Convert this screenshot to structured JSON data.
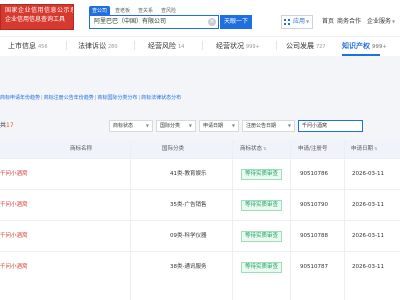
{
  "header": {
    "logo_line1": "国家企业信用信息公示系统",
    "logo_line2": "企业信用信息查询工具",
    "search_tabs": [
      "查公司",
      "查老板",
      "查关系",
      "查风险"
    ],
    "search_value": "阿里巴巴（中国）有限公司",
    "search_button": "天眼一下",
    "apps_label": "应用",
    "links": [
      "首页",
      "商务合作",
      "企业服务"
    ]
  },
  "tabs": [
    {
      "label": "上市信息",
      "count": "456"
    },
    {
      "label": "法律诉讼",
      "count": "280"
    },
    {
      "label": "经营风险",
      "count": "14"
    },
    {
      "label": "经营状况",
      "count": "999+"
    },
    {
      "label": "公司发展",
      "count": "727"
    },
    {
      "label": "知识产权",
      "count": "999+"
    }
  ],
  "subnav": [
    "商标申请年份趋势",
    "商标注册公告年份趋势",
    "商标国际分类分布",
    "商标法律状态分布"
  ],
  "filters": {
    "total_prefix": "共",
    "total_count": "17",
    "status_label": "商标状态",
    "intl_label": "国际分类",
    "apply_date_label": "申请日期",
    "reg_date_label": "注册公告日期",
    "keyword": "千问小酒窝"
  },
  "table": {
    "headers": [
      "商标名称",
      "国际分类",
      "商标状态",
      "申请/注册号",
      "申请日期"
    ],
    "rows": [
      {
        "name": "千问小酒窝",
        "class": "41类-教育娱乐",
        "status": "等待实质审查",
        "number": "90510786",
        "date": "2026-03-11"
      },
      {
        "name": "千问小酒窝",
        "class": "35类-广告销售",
        "status": "等待实质审查",
        "number": "90510790",
        "date": "2026-03-11"
      },
      {
        "name": "千问小酒窝",
        "class": "09类-科学仪器",
        "status": "等待实质审查",
        "number": "90510788",
        "date": "2026-03-11"
      },
      {
        "name": "千问小酒窝",
        "class": "38类-通讯服务",
        "status": "等待实质审查",
        "number": "90510787",
        "date": "2026-03-11"
      }
    ]
  }
}
